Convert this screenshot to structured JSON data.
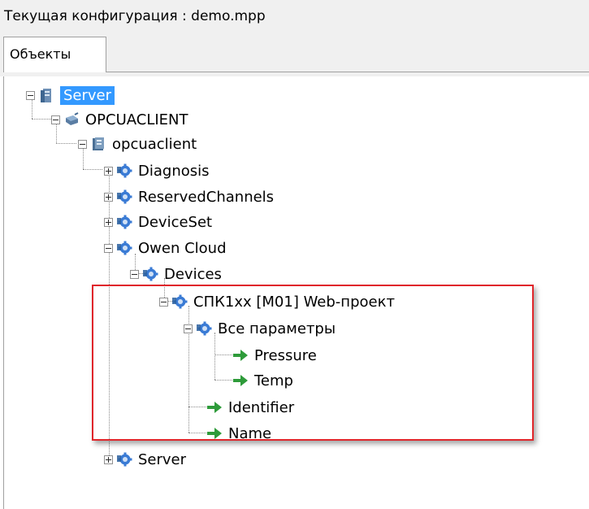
{
  "window": {
    "title": "Текущая конфигурация : demo.mpp"
  },
  "tabs": [
    {
      "label": "Объекты",
      "active": true
    }
  ],
  "tree": {
    "server": {
      "label": "Server",
      "icon": "server-icon",
      "selected": true
    },
    "opcuaclient_module": {
      "label": "OPCUACLIENT",
      "icon": "network-module-icon"
    },
    "opcuaclient": {
      "label": "opcuaclient",
      "icon": "client-icon"
    },
    "diagnosis": {
      "label": "Diagnosis",
      "icon": "folder-object-icon"
    },
    "reserved_channels": {
      "label": "ReservedChannels",
      "icon": "folder-object-icon"
    },
    "device_set": {
      "label": "DeviceSet",
      "icon": "folder-object-icon"
    },
    "owen_cloud": {
      "label": "Owen Cloud",
      "icon": "folder-object-icon"
    },
    "devices": {
      "label": "Devices",
      "icon": "folder-object-icon"
    },
    "spk_project": {
      "label": "СПК1xx [M01] Web-проект",
      "icon": "folder-object-icon"
    },
    "all_params": {
      "label": "Все параметры",
      "icon": "folder-object-icon"
    },
    "pressure": {
      "label": "Pressure",
      "icon": "variable-arrow-icon"
    },
    "temp": {
      "label": "Temp",
      "icon": "variable-arrow-icon"
    },
    "identifier": {
      "label": "Identifier",
      "icon": "variable-arrow-icon"
    },
    "name": {
      "label": "Name",
      "icon": "variable-arrow-icon"
    },
    "server2": {
      "label": "Server",
      "icon": "folder-object-icon"
    }
  },
  "colors": {
    "selection": "#3399ff",
    "highlight_box": "#e0262b",
    "object_icon": "#3a7bd5",
    "variable_arrow": "#2e9b3a"
  }
}
